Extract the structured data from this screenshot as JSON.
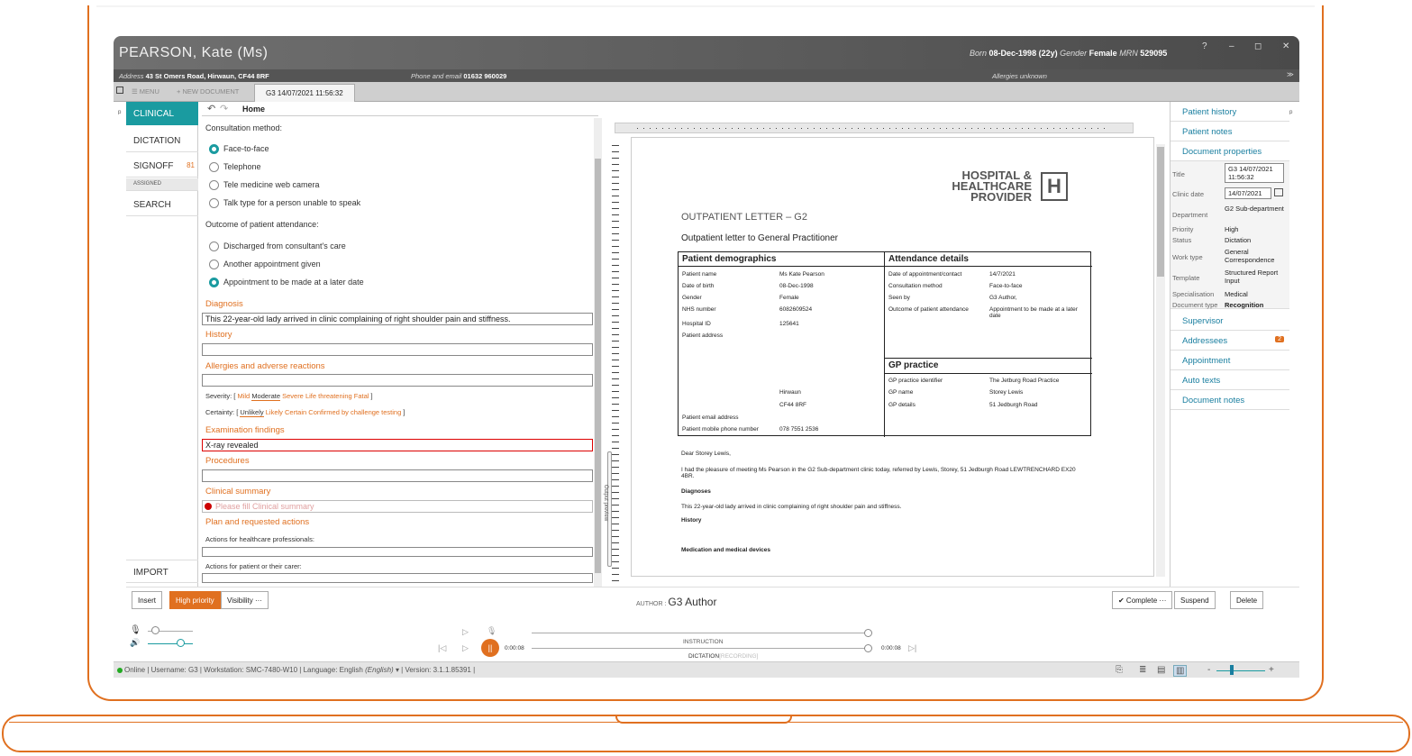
{
  "patient": {
    "name": "PEARSON, Kate (Ms)",
    "born_label": "Born",
    "born": "08-Dec-1998 (22y)",
    "gender_label": "Gender",
    "gender": "Female",
    "mrn_label": "MRN",
    "mrn": "529095",
    "address_label": "Address",
    "address": "43 St Omers Road, Hirwaun, CF44 8RF",
    "phone_label": "Phone and email",
    "phone": "01632 960029",
    "allergies": "Allergies unknown"
  },
  "window": {
    "help": "?",
    "minimize": "–",
    "maximize": "◻",
    "close": "✕",
    "expand": "≫"
  },
  "tabs": {
    "menu": "☰ MENU",
    "new_document": "+ NEW DOCUMENT",
    "active_doc": "G3 14/07/2021 11:56:32"
  },
  "nav": {
    "clinical": "CLINICAL",
    "dictation": "DICTATION",
    "signoff": "SIGNOFF",
    "signoff_count": "81",
    "assigned": "ASSIGNED",
    "search": "SEARCH",
    "import": "IMPORT"
  },
  "form": {
    "toolbar_home": "Home",
    "consultation_label": "Consultation method:",
    "consultation_options": [
      "Face-to-face",
      "Telephone",
      "Tele medicine web camera",
      "Talk type for a person unable to speak"
    ],
    "outcome_label": "Outcome of patient attendance:",
    "outcome_options": [
      "Discharged from consultant's care",
      "Another appointment given",
      "Appointment to be made at a later date"
    ],
    "diagnosis_label": "Diagnosis",
    "diagnosis_value": "This 22-year-old lady arrived in clinic complaining of right shoulder pain and stiffness.",
    "history_label": "History",
    "allergies_label": "Allergies and adverse reactions",
    "severity_label": "Severity:",
    "severity": [
      "Mild",
      "Moderate",
      "Severe",
      "Life threatening",
      "Fatal"
    ],
    "certainty_label": "Certainty:",
    "certainty": [
      "Unlikely",
      "Likely",
      "Certain",
      "Confirmed by challenge testing"
    ],
    "exam_label": "Examination findings",
    "exam_value": "X-ray revealed",
    "procedures_label": "Procedures",
    "clinical_summary_label": "Clinical summary",
    "clinical_summary_placeholder": "Please fill Clinical summary",
    "plan_label": "Plan and requested actions",
    "actions_hp_label": "Actions for healthcare professionals:",
    "actions_patient_label": "Actions for patient or their carer:"
  },
  "preview": {
    "logo_line1": "HOSPITAL &",
    "logo_line2": "HEALTHCARE",
    "logo_line3": "PROVIDER",
    "title": "OUTPATIENT LETTER – G2",
    "subtitle": "Outpatient letter to General Practitioner",
    "demographics_header": "Patient demographics",
    "attendance_header": "Attendance details",
    "gp_header": "GP practice",
    "demo_labels": [
      "Patient name",
      "Date of birth",
      "Gender",
      "NHS number",
      "Hospital ID",
      "Patient address"
    ],
    "demo_values": [
      "Ms Kate Pearson",
      "08-Dec-1998",
      "Female",
      "6082609524",
      "125641"
    ],
    "addr_lines": [
      "Hirwaun",
      "CF44 8RF"
    ],
    "email_label": "Patient email address",
    "mobile_label": "Patient mobile phone number",
    "mobile": "078 7551 2536",
    "att_labels": [
      "Date of appointment/contact",
      "Consultation method",
      "Seen by",
      "Outcome of patient attendance"
    ],
    "att_values": [
      "14/7/2021",
      "Face-to-face",
      "G3 Author,",
      "Appointment to be made at a later date"
    ],
    "gp_labels": [
      "GP practice identifier",
      "GP name",
      "GP details"
    ],
    "gp_values": [
      "The Jetburg Road Practice",
      "Storey Lewis",
      "51 Jedburgh Road"
    ],
    "dear": "Dear  Storey Lewis,",
    "para1": "I had the pleasure of meeting Ms Pearson in the G2 Sub-department clinic today, referred by Lewis, Storey, 51 Jedburgh Road LEWTRENCHARD EX20 4BR.",
    "diag_h": "Diagnoses",
    "diag_t": "This 22-year-old lady arrived in clinic complaining of right shoulder pain and stiffness.",
    "hist_h": "History",
    "med_h": "Medication and medical devices",
    "side_label": "Output preview"
  },
  "right": {
    "patient_history": "Patient history",
    "patient_notes": "Patient notes",
    "document_properties": "Document properties",
    "props": {
      "title_k": "Title",
      "title_v": "G3 14/07/2021 11:56:32",
      "clinic_k": "Clinic date",
      "clinic_v": "14/07/2021",
      "dept_k": "Department",
      "dept_v": "G2 Sub-department",
      "priority_k": "Priority",
      "priority_v": "High",
      "status_k": "Status",
      "status_v": "Dictation",
      "worktype_k": "Work type",
      "worktype_v": "General Correspondence",
      "template_k": "Template",
      "template_v": "Structured Report Input",
      "spec_k": "Specialisation",
      "spec_v": "Medical",
      "doctype_k": "Document type",
      "doctype_v": "Recognition"
    },
    "supervisor": "Supervisor",
    "addressees": "Addressees",
    "addressees_count": "2",
    "appointment": "Appointment",
    "auto_texts": "Auto texts",
    "document_notes": "Document notes"
  },
  "bottom": {
    "insert": "Insert",
    "high_priority": "High priority",
    "visibility": "Visibility ···",
    "author_label": "AUTHOR :",
    "author": "G3 Author",
    "complete": "✔ Complete ···",
    "suspend": "Suspend",
    "delete": "Delete",
    "instruction": "INSTRUCTION",
    "dictation": "DICTATION",
    "recording": "[RECORDING]",
    "time_start": "0:00:08",
    "time_end": "0:00:08"
  },
  "status": {
    "text": "Online | Username: G3 | Workstation: SMC-7480-W10 | Language: English",
    "lang_italic": "(English)",
    "version": "▾ | Version: 3.1.1.85391 |",
    "zoom_minus": "-",
    "zoom_plus": "+"
  }
}
